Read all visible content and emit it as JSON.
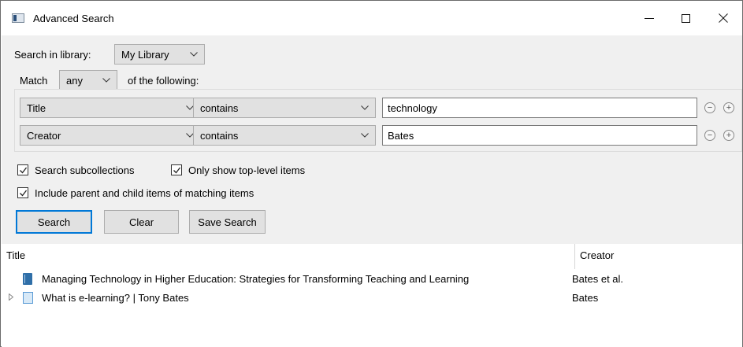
{
  "window": {
    "title": "Advanced Search",
    "minimize_label": "—",
    "maximize_label": "",
    "close_label": "✕"
  },
  "search": {
    "library_label": "Search in library:",
    "library_value": "My Library",
    "match_label": "Match",
    "match_value": "any",
    "following_label": "of the following:",
    "conditions": [
      {
        "field": "Title",
        "operator": "contains",
        "value": "technology"
      },
      {
        "field": "Creator",
        "operator": "contains",
        "value": "Bates"
      }
    ],
    "remove_symbol": "−",
    "add_symbol": "+",
    "options": {
      "subcollections": {
        "label": "Search subcollections",
        "checked": true
      },
      "top_level": {
        "label": "Only show top-level items",
        "checked": true
      },
      "include_parent_child": {
        "label": "Include parent and child items of matching items",
        "checked": true
      }
    },
    "buttons": {
      "search": "Search",
      "clear": "Clear",
      "save": "Save Search"
    }
  },
  "results": {
    "columns": {
      "title": "Title",
      "creator": "Creator"
    },
    "rows": [
      {
        "title": "Managing Technology in Higher Education: Strategies for Transforming Teaching and Learning",
        "creator": "Bates et al.",
        "icon": "book-icon",
        "has_children": false
      },
      {
        "title": "What is e-learning? | Tony Bates",
        "creator": "Bates",
        "icon": "web-page-icon",
        "has_children": true
      }
    ]
  }
}
